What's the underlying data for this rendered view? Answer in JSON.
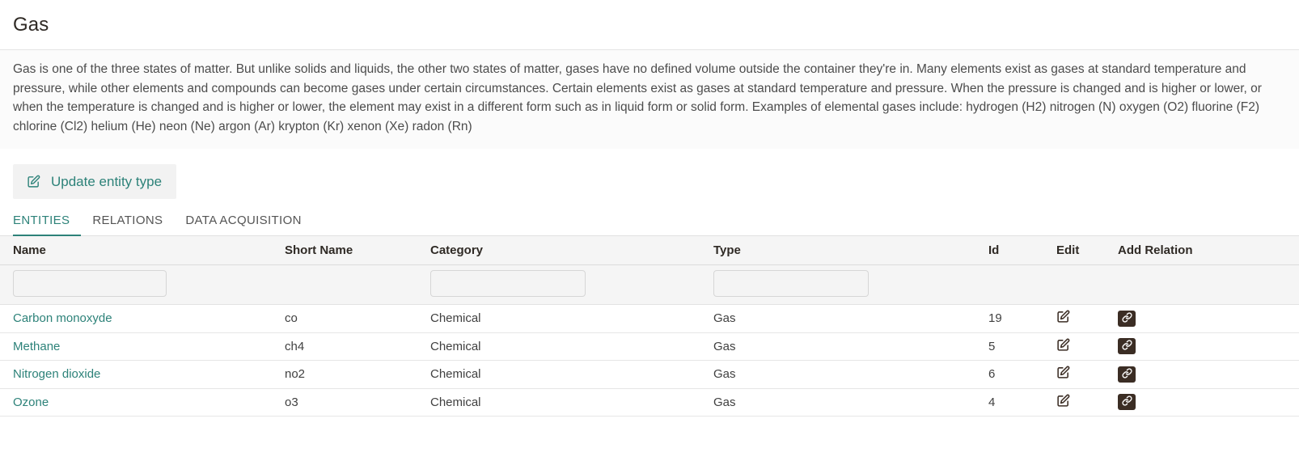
{
  "header": {
    "title": "Gas"
  },
  "description": {
    "text": "Gas is one of the three states of matter. But unlike solids and liquids, the other two states of matter, gases have no defined volume outside the container they're in. Many elements exist as gases at standard temperature and pressure, while other elements and compounds can become gases under certain circumstances. Certain elements exist as gases at standard temperature and pressure. When the pressure is changed and is higher or lower, or when the temperature is changed and is higher or lower, the element may exist in a different form such as in liquid form or solid form. Examples of elemental gases include: hydrogen (H2) nitrogen (N) oxygen (O2) fluorine (F2) chlorine (Cl2) helium (He) neon (Ne) argon (Ar) krypton (Kr) xenon (Xe) radon (Rn)"
  },
  "actions": {
    "update_entity_type_label": "Update entity type",
    "update_entity_type_icon": "edit-square-icon"
  },
  "tabs": [
    {
      "label": "ENTITIES",
      "active": true
    },
    {
      "label": "RELATIONS",
      "active": false
    },
    {
      "label": "DATA ACQUISITION",
      "active": false
    }
  ],
  "table": {
    "columns": [
      {
        "key": "name",
        "label": "Name"
      },
      {
        "key": "short_name",
        "label": "Short Name"
      },
      {
        "key": "category",
        "label": "Category"
      },
      {
        "key": "type",
        "label": "Type"
      },
      {
        "key": "id",
        "label": "Id"
      },
      {
        "key": "edit",
        "label": "Edit"
      },
      {
        "key": "add_relation",
        "label": "Add Relation"
      }
    ],
    "filters": {
      "name": {
        "value": "",
        "placeholder": ""
      },
      "category": {
        "value": "",
        "placeholder": ""
      },
      "type": {
        "value": "",
        "placeholder": ""
      }
    },
    "rows": [
      {
        "name": "Carbon monoxyde",
        "short_name": "co",
        "category": "Chemical",
        "type": "Gas",
        "id": "19",
        "edit_icon": "edit-square-icon",
        "relation_icon": "link-icon"
      },
      {
        "name": "Methane",
        "short_name": "ch4",
        "category": "Chemical",
        "type": "Gas",
        "id": "5",
        "edit_icon": "edit-square-icon",
        "relation_icon": "link-icon"
      },
      {
        "name": "Nitrogen dioxide",
        "short_name": "no2",
        "category": "Chemical",
        "type": "Gas",
        "id": "6",
        "edit_icon": "edit-square-icon",
        "relation_icon": "link-icon"
      },
      {
        "name": "Ozone",
        "short_name": "o3",
        "category": "Chemical",
        "type": "Gas",
        "id": "4",
        "edit_icon": "edit-square-icon",
        "relation_icon": "link-icon"
      }
    ]
  },
  "colors": {
    "accent": "#2d8279",
    "relation_button_bg": "#3b2d24",
    "header_bg": "#f5f5f5",
    "text": "#404040"
  }
}
